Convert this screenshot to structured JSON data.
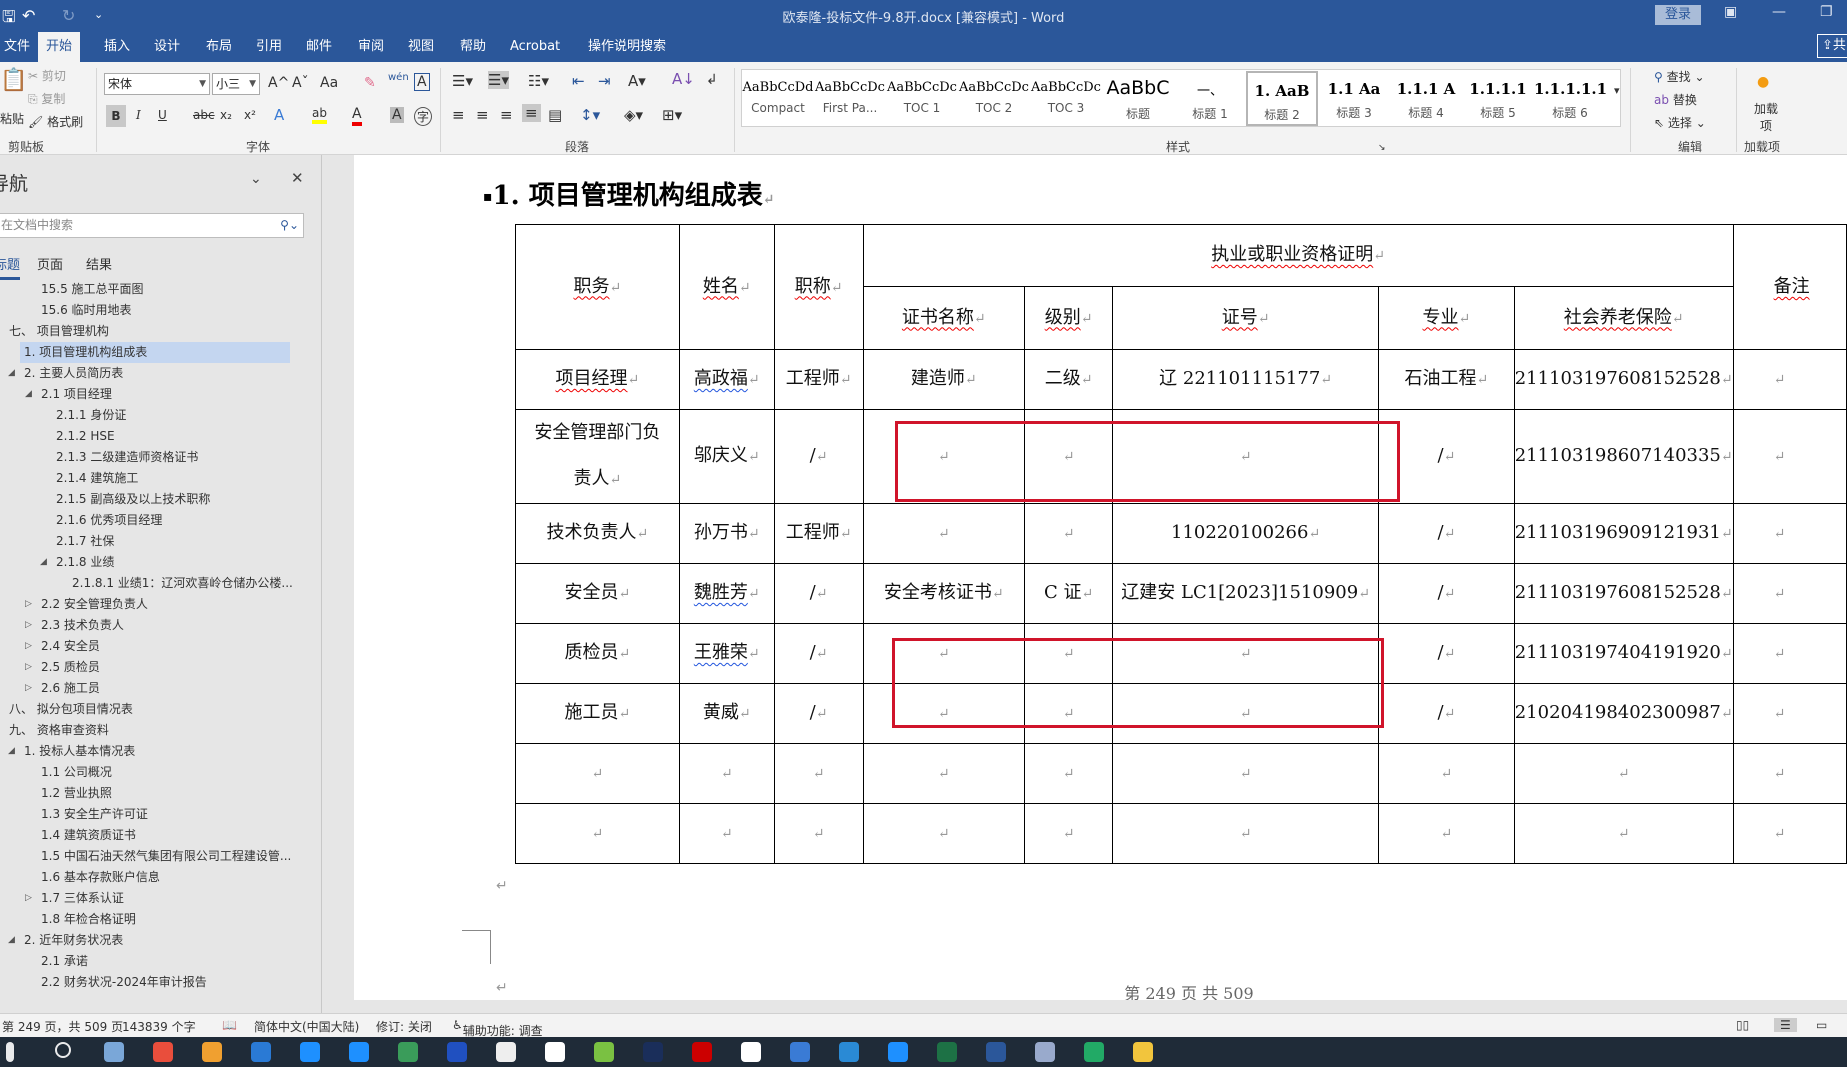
{
  "titlebar": {
    "title": "欧泰隆-投标文件-9.8开.docx [兼容模式]  -  Word",
    "login": "登录",
    "quick_access": {
      "save": "🖫",
      "undo": "↶",
      "redo": "↻",
      "customize": "⌄"
    }
  },
  "ribbon_tabs": [
    "文件",
    "开始",
    "插入",
    "设计",
    "布局",
    "引用",
    "邮件",
    "审阅",
    "视图",
    "帮助",
    "Acrobat",
    "操作说明搜索"
  ],
  "share_label": "共",
  "ribbon": {
    "clipboard": {
      "paste": "粘贴",
      "cut": "剪切",
      "copy": "复制",
      "format_painter": "格式刷",
      "label": "剪贴板"
    },
    "font": {
      "font_name": "宋体",
      "font_size": "小三",
      "label": "字体",
      "bold": "B",
      "italic": "I",
      "underline": "U",
      "strike": "abc",
      "sub": "x₂",
      "sup": "x²",
      "grow": "A^",
      "shrink": "Aˇ",
      "case": "Aa",
      "clear": "✎",
      "phonetic": "wén",
      "border": "A",
      "effects": "A",
      "highlight": "ab",
      "color": "A",
      "shade": "A",
      "enclose": "字"
    },
    "paragraph": {
      "label": "段落"
    },
    "styles": {
      "label": "样式",
      "items": [
        {
          "preview": "AaBbCcDd",
          "name": "Compact"
        },
        {
          "preview": "AaBbCcDc",
          "name": "First Pa..."
        },
        {
          "preview": "AaBbCcDc",
          "name": "TOC 1"
        },
        {
          "preview": "AaBbCcDc",
          "name": "TOC 2"
        },
        {
          "preview": "AaBbCcDc",
          "name": "TOC 3"
        },
        {
          "preview": "AaBbC",
          "name": "标题"
        },
        {
          "preview": "一、 ",
          "name": "标题 1"
        },
        {
          "preview": "1.  AaB",
          "name": "标题 2"
        },
        {
          "preview": "1.1  Aa",
          "name": "标题 3"
        },
        {
          "preview": "1.1.1  A",
          "name": "标题 4"
        },
        {
          "preview": "1.1.1.1",
          "name": "标题 5"
        },
        {
          "preview": "1.1.1.1.1",
          "name": "标题 6"
        }
      ],
      "selected": "标题 2"
    },
    "editing": {
      "find": "查找",
      "replace": "替换",
      "select": "选择",
      "label": "编辑"
    },
    "addins": {
      "button": "加载项",
      "label": "加载项"
    }
  },
  "nav": {
    "title": "导航",
    "search_placeholder": "在文档中搜索",
    "tabs": [
      "标题",
      "页面",
      "结果"
    ],
    "active_tab": "标题",
    "items": [
      {
        "label": "15.5 施工总平面图",
        "level": 2,
        "exp": ""
      },
      {
        "label": "15.6 临时用地表",
        "level": 2,
        "exp": ""
      },
      {
        "label": "七、  项目管理机构",
        "level": 0,
        "exp": ""
      },
      {
        "label": "1. 项目管理机构组成表",
        "level": 1,
        "exp": "",
        "selected": true
      },
      {
        "label": "2. 主要人员简历表",
        "level": 1,
        "exp": "open"
      },
      {
        "label": "2.1 项目经理",
        "level": 2,
        "exp": "open"
      },
      {
        "label": "2.1.1 身份证",
        "level": 3,
        "exp": ""
      },
      {
        "label": "2.1.2 HSE",
        "level": 3,
        "exp": ""
      },
      {
        "label": "2.1.3 二级建造师资格证书",
        "level": 3,
        "exp": ""
      },
      {
        "label": "2.1.4 建筑施工",
        "level": 3,
        "exp": ""
      },
      {
        "label": "2.1.5 副高级及以上技术职称",
        "level": 3,
        "exp": ""
      },
      {
        "label": "2.1.6 优秀项目经理",
        "level": 3,
        "exp": ""
      },
      {
        "label": "2.1.7 社保",
        "level": 3,
        "exp": ""
      },
      {
        "label": "2.1.8 业绩",
        "level": 3,
        "exp": "open"
      },
      {
        "label": "2.1.8.1 业绩1：辽河欢喜岭仓储办公楼...",
        "level": 4,
        "exp": ""
      },
      {
        "label": "2.2 安全管理负责人",
        "level": 2,
        "exp": "closed"
      },
      {
        "label": "2.3 技术负责人",
        "level": 2,
        "exp": "closed"
      },
      {
        "label": "2.4 安全员",
        "level": 2,
        "exp": "closed"
      },
      {
        "label": "2.5 质检员",
        "level": 2,
        "exp": "closed"
      },
      {
        "label": "2.6 施工员",
        "level": 2,
        "exp": "closed"
      },
      {
        "label": "八、  拟分包项目情况表",
        "level": 0,
        "exp": ""
      },
      {
        "label": "九、  资格审查资料",
        "level": 0,
        "exp": ""
      },
      {
        "label": "1. 投标人基本情况表",
        "level": 1,
        "exp": "open"
      },
      {
        "label": "1.1 公司概况",
        "level": 2,
        "exp": ""
      },
      {
        "label": "1.2 营业执照",
        "level": 2,
        "exp": ""
      },
      {
        "label": "1.3 安全生产许可证",
        "level": 2,
        "exp": ""
      },
      {
        "label": "1.4 建筑资质证书",
        "level": 2,
        "exp": ""
      },
      {
        "label": "1.5 中国石油天然气集团有限公司工程建设管...",
        "level": 2,
        "exp": ""
      },
      {
        "label": "1.6 基本存款账户信息",
        "level": 2,
        "exp": ""
      },
      {
        "label": "1.7 三体系认证",
        "level": 2,
        "exp": "closed"
      },
      {
        "label": "1.8 年检合格证明",
        "level": 2,
        "exp": ""
      },
      {
        "label": "2. 近年财务状况表",
        "level": 1,
        "exp": "open"
      },
      {
        "label": "2.1 承诺",
        "level": 2,
        "exp": ""
      },
      {
        "label": "2.2 财务状况-2024年审计报告",
        "level": 2,
        "exp": ""
      }
    ]
  },
  "document": {
    "heading": "1.  项目管理机构组成表",
    "table": {
      "headers": {
        "position": "职务",
        "name": "姓名",
        "title": "职称",
        "cert_group": "执业或职业资格证明",
        "remark": "备注",
        "cert_name": "证书名称",
        "level": "级别",
        "cert_no": "证号",
        "major": "专业",
        "pension": "社会养老保险"
      },
      "rows": [
        [
          "项目经理",
          "高政福",
          "工程师",
          "建造师",
          "二级",
          "辽 221101115177",
          "石油工程",
          "211103197608152528",
          ""
        ],
        [
          "安全管理部门负责人",
          "邬庆义",
          "/",
          "",
          "",
          "",
          "/",
          "211103198607140335",
          ""
        ],
        [
          "技术负责人",
          "孙万书",
          "工程师",
          "",
          "",
          "110220100266",
          "/",
          "211103196909121931",
          ""
        ],
        [
          "安全员",
          "魏胜芳",
          "/",
          "安全考核证书",
          "C 证",
          "辽建安 LC1[2023]1510909",
          "/",
          "211103197608152528",
          ""
        ],
        [
          "质检员",
          "王雅荣",
          "/",
          "",
          "",
          "",
          "/",
          "211103197404191920",
          ""
        ],
        [
          "施工员",
          "黄威",
          "/",
          "",
          "",
          "",
          "/",
          "210204198402300987",
          ""
        ],
        [
          "",
          "",
          "",
          "",
          "",
          "",
          "",
          "",
          ""
        ],
        [
          "",
          "",
          "",
          "",
          "",
          "",
          "",
          "",
          ""
        ]
      ]
    },
    "footer": "第  249  页  共  509",
    "highlight_color": "#d0142a"
  },
  "status": {
    "page": "第 249 页，共 509 页",
    "words": "143839 个字",
    "language": "简体中文(中国大陆)",
    "track": "修订: 关闭",
    "accessibility": "辅助功能: 调查"
  }
}
